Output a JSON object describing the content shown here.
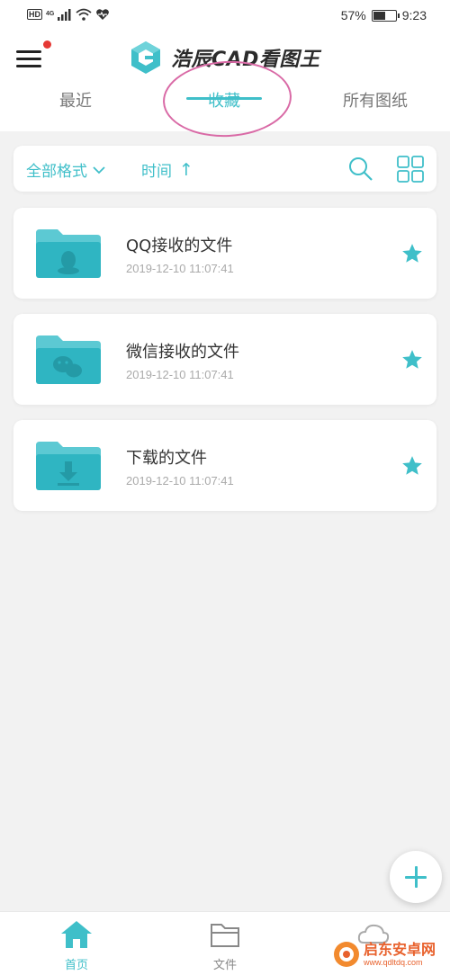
{
  "status_bar": {
    "hd": "HD",
    "network": "4G",
    "battery": "57%",
    "battery_level": 0.57,
    "time": "9:23"
  },
  "header": {
    "app_name": "浩辰CAD看图王",
    "tabs": [
      {
        "label": "最近",
        "active": false
      },
      {
        "label": "收藏",
        "active": true
      },
      {
        "label": "所有图纸",
        "active": false
      }
    ]
  },
  "filter": {
    "format_label": "全部格式",
    "time_label": "时间",
    "sort_arrow": "↑"
  },
  "files": [
    {
      "name": "QQ接收的文件",
      "date": "2019-12-10 11:07:41",
      "icon": "qq-folder-icon",
      "starred": true
    },
    {
      "name": "微信接收的文件",
      "date": "2019-12-10 11:07:41",
      "icon": "wechat-folder-icon",
      "starred": true
    },
    {
      "name": "下载的文件",
      "date": "2019-12-10 11:07:41",
      "icon": "download-folder-icon",
      "starred": true
    }
  ],
  "bottom_nav": [
    {
      "label": "首页",
      "icon": "home-icon",
      "active": true
    },
    {
      "label": "文件",
      "icon": "folder-icon",
      "active": false
    },
    {
      "label": "",
      "icon": "cloud-icon",
      "active": false
    }
  ],
  "watermark": {
    "text": "启东安卓网",
    "url": "www.qdltdq.com"
  },
  "colors": {
    "accent": "#3fbfc9",
    "annotation": "#d96aa6",
    "notification_dot": "#e53935"
  }
}
